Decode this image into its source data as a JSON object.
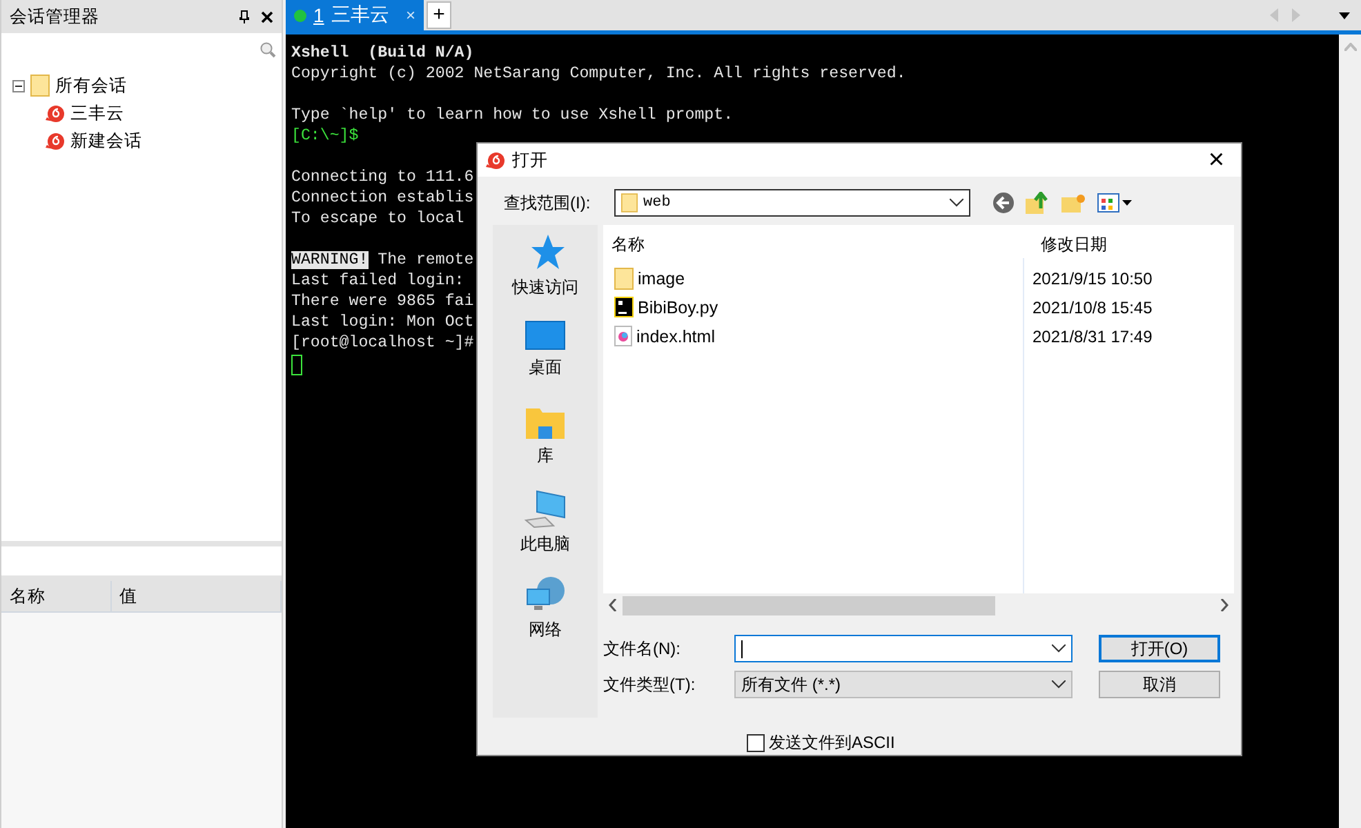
{
  "session_panel": {
    "title": "会话管理器",
    "tree": [
      {
        "label": "所有会话",
        "expanded": true,
        "kind": "folder",
        "children": [
          {
            "label": "三丰云",
            "kind": "session"
          },
          {
            "label": "新建会话",
            "kind": "session"
          }
        ]
      }
    ],
    "properties": {
      "columns": [
        "名称",
        "值"
      ]
    }
  },
  "tabs": [
    {
      "number": "1",
      "label": "三丰云",
      "selected": true,
      "connected": true,
      "close": "×"
    }
  ],
  "add_tab": "+",
  "terminal": {
    "lines": [
      {
        "kind": "title",
        "text": "Xshell  (Build N/A)"
      },
      {
        "kind": "text",
        "text": "Copyright (c) 2002 NetSarang Computer, Inc. All rights reserved."
      },
      {
        "kind": "blank"
      },
      {
        "kind": "text",
        "text": "Type `help' to learn how to use Xshell prompt."
      },
      {
        "kind": "prompt",
        "text": "[C:\\~]$"
      },
      {
        "kind": "blank"
      },
      {
        "kind": "text",
        "text": "Connecting to 111.6"
      },
      {
        "kind": "text",
        "text": "Connection establis"
      },
      {
        "kind": "text",
        "text": "To escape to local"
      },
      {
        "kind": "blank"
      },
      {
        "kind": "warning",
        "tag": "WARNING!",
        "text": " The remote"
      },
      {
        "kind": "text",
        "text": "Last failed login:"
      },
      {
        "kind": "text",
        "text": "There were 9865 fai"
      },
      {
        "kind": "text",
        "text": "Last login: Mon Oct"
      },
      {
        "kind": "text",
        "text": "[root@localhost ~]#"
      },
      {
        "kind": "cursor"
      }
    ]
  },
  "dialog": {
    "title": "打开",
    "close": "×",
    "look_in_label": "查找范围(I):",
    "look_in_value": "web",
    "places": [
      {
        "kind": "quick",
        "label": "快速访问"
      },
      {
        "kind": "desktop",
        "label": "桌面"
      },
      {
        "kind": "library",
        "label": "库"
      },
      {
        "kind": "computer",
        "label": "此电脑"
      },
      {
        "kind": "network",
        "label": "网络"
      }
    ],
    "columns": [
      "名称",
      "修改日期"
    ],
    "files": [
      {
        "kind": "folder",
        "name": "image",
        "modified": "2021/9/15 10:50"
      },
      {
        "kind": "python",
        "name": "BibiBoy.py",
        "modified": "2021/10/8 15:45"
      },
      {
        "kind": "html",
        "name": "index.html",
        "modified": "2021/8/31 17:49"
      }
    ],
    "file_name_label": "文件名(N):",
    "file_type_label": "文件类型(T):",
    "file_type_value": "所有文件 (*.*)",
    "open_button": "打开(O)",
    "cancel_button": "取消",
    "ascii_option": {
      "label": "发送文件到ASCII",
      "checked": false
    }
  }
}
